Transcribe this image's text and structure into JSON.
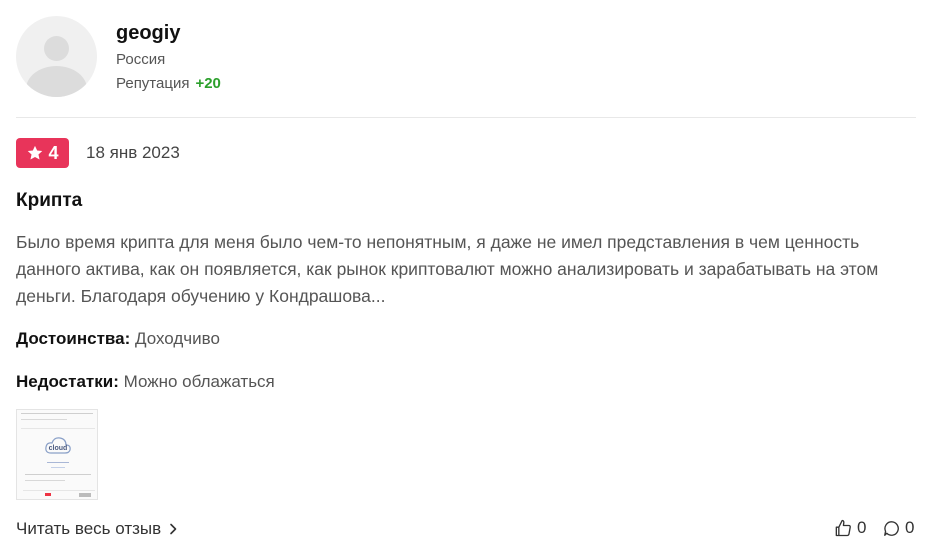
{
  "user": {
    "name": "geogiy",
    "country": "Россия",
    "reputation_label": "Репутация",
    "reputation_value": "+20"
  },
  "review": {
    "rating": "4",
    "date": "18 янв 2023",
    "title": "Крипта",
    "text": "Было время крипта для меня было чем-то непонятным, я даже не имел представления в чем ценность данного актива, как он появляется, как рынок криптовалют можно анализировать и зарабатывать на этом деньги. Благодаря обучению у Кондрашова...",
    "pros_label": "Достоинства:",
    "pros_value": "Доходчиво",
    "cons_label": "Недостатки:",
    "cons_value": "Можно облажаться"
  },
  "attachment": {
    "caption": "cloud"
  },
  "footer": {
    "read_more": "Читать весь отзыв",
    "likes": "0",
    "comments": "0"
  },
  "colors": {
    "rating_badge": "#e8345a",
    "reputation_positive": "#2ca02c"
  }
}
